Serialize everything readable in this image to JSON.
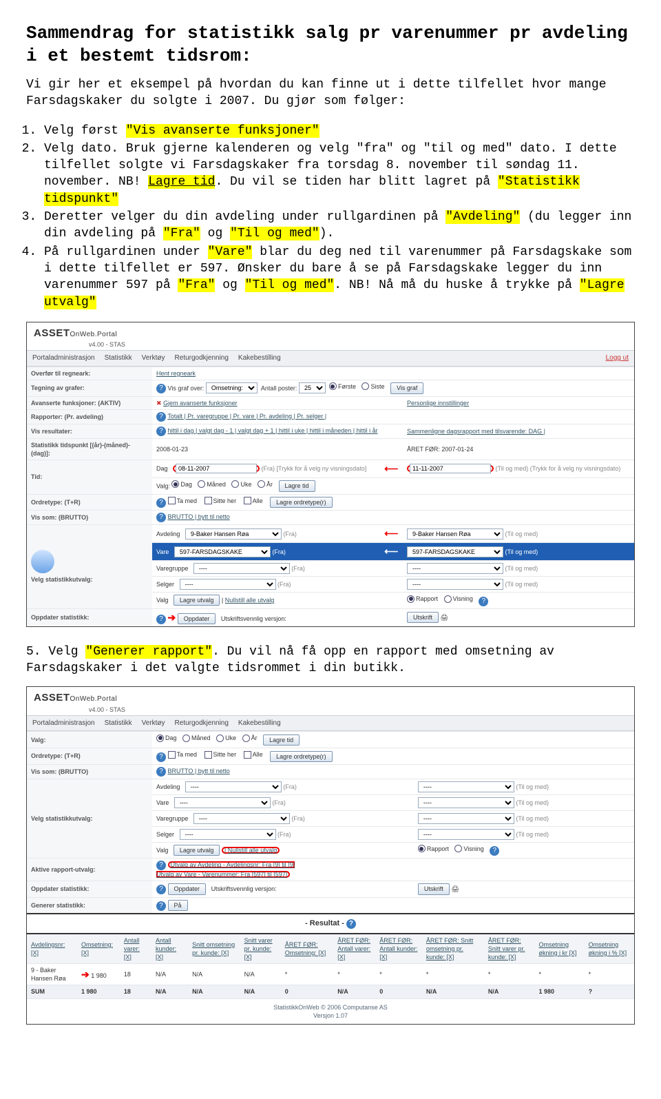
{
  "title": "Sammendrag for statistikk salg pr varenummer pr avdeling i et bestemt tidsrom:",
  "intro": "Vi gir her et eksempel på hvordan du kan finne ut i dette tilfellet hvor mange Farsdagskaker du solgte i 2007. Du gjør som følger:",
  "step1_a": "Velg først ",
  "step1_hl": "\"Vis avanserte funksjoner\"",
  "step2_a": "Velg dato. Bruk gjerne kalenderen og velg \"fra\" og \"til og med\" dato. I dette tilfellet solgte vi Farsdagskaker fra torsdag 8. november til søndag 11. november. NB! ",
  "step2_hl": "Lagre tid",
  "step2_b": ". Du vil se tiden har blitt lagret på ",
  "step2_hl2": "\"Statistikk tidspunkt\"",
  "step3_a": "Deretter velger du din avdeling under rullgardinen på ",
  "step3_hl1": "\"Avdeling\"",
  "step3_b": " (du legger inn din avdeling på ",
  "step3_hl2": "\"Fra\"",
  "step3_c": " og ",
  "step3_hl3": "\"Til og med\"",
  "step3_d": ").",
  "step4_a": "På rullgardinen under ",
  "step4_hl1": "\"Vare\"",
  "step4_b": " blar du deg ned til varenummer på Farsdagskake som i dette tilfellet er 597. Ønsker du bare å se på Farsdagskake legger du inn varenummer 597 på ",
  "step4_hl2": "\"Fra\"",
  "step4_c": " og ",
  "step4_hl3": "\"Til og med\"",
  "step4_d": ". NB! Nå må du huske å trykke på ",
  "step4_hl4": "\"Lagre utvalg\"",
  "step5_a": "5. Velg ",
  "step5_hl": "\"Generer rapport\"",
  "step5_b": ". Du vil nå få opp en rapport med omsetning av Farsdagskaker i det valgte tidsrommet i din butikk.",
  "logo": {
    "brand": "ASSET",
    "suffix": "OnWeb.Portal",
    "ver": "v4.00 - STAS"
  },
  "menu": [
    "Portaladministrasjon",
    "Statistikk",
    "Verktøy",
    "Returgodkjenning",
    "Kakebestilling"
  ],
  "logout": "Logg ut",
  "s1": {
    "rows": {
      "overfor": {
        "lab": "Overfør til regneark:",
        "act": "Hent regneark"
      },
      "tegn": {
        "lab": "Tegning av grafer:",
        "vis_label": "Vis graf over:",
        "vis_sel": "Omsetning:",
        "ant": "Antall poster:",
        "ant_sel": "25",
        "forste": "Første",
        "siste": "Siste",
        "btn": "Vis graf"
      },
      "avans": {
        "lab": "Avanserte funksjoner: (AKTIV)",
        "act": "Gjem avanserte funksjoner",
        "pers": "Personlige innstillinger"
      },
      "rapp": {
        "lab": "Rapporter: (Pr. avdeling)",
        "links": "Totalt | Pr. varegruppe | Pr. vare | Pr. avdeling | Pr. selger |"
      },
      "visres": {
        "lab": "Vis resultater:",
        "links": "hittil i dag | valgt dag - 1 | valgt dag + 1 | hittil i uke | hittil i måneden | hittil i år",
        "cmp": "Sammenligne dagsrapport med tilsvarende: DAG |"
      },
      "stat": {
        "lab": "Statistikk tidspunkt [(år)-(måned)-(dag)]:",
        "val": "2008-01-23",
        "prev": "ÅRET FØR: 2007-01-24"
      },
      "tid": {
        "lab": "Tid:",
        "dag": "Dag",
        "fra": "08-11-2007",
        "fra_lab": "(Fra) [Trykk for å velg ny visningsdato]",
        "til": "11-11-2007",
        "til_lab": "(Til og med) (Trykk for å velg ny visningsdato)",
        "valg": "Valg:",
        "r": [
          "Dag",
          "Måned",
          "Uke",
          "År"
        ],
        "btn": "Lagre tid"
      },
      "ord": {
        "lab": "Ordretype: (T+R)",
        "c": [
          "Ta med",
          "Sitte her",
          "Alle"
        ],
        "btn": "Lagre ordretype(r)"
      },
      "vis": {
        "lab": "Vis som: (BRUTTO)",
        "txt": "BRUTTO | bytt til netto"
      },
      "utvalg": {
        "lab": "Velg statistikkutvalg:",
        "avd": {
          "lab": "Avdeling",
          "fra": "9-Baker Hansen Røa",
          "til": "9-Baker Hansen Røa"
        },
        "vare": {
          "lab": "Vare",
          "fra": "597-FARSDAGSKAKE",
          "til": "597-FARSDAGSKAKE"
        },
        "vgrp": {
          "lab": "Varegruppe",
          "fra": "----",
          "til": "----"
        },
        "selg": {
          "lab": "Selger",
          "fra": "----",
          "til": "----"
        },
        "fra": "(Fra)",
        "til": "(Til og med)",
        "lagre": "Lagre utvalg",
        "null": "Nullstill alle utvalg",
        "rad1": "Rapport",
        "rad2": "Visning"
      },
      "opp": {
        "lab": "Oppdater statistikk:",
        "btn": "Oppdater",
        "uts": "Utskriftsvennlig versjon:",
        "utbtn": "Utskrift"
      }
    }
  },
  "s2": {
    "rows": {
      "valg": {
        "lab": "Valg:",
        "r": [
          "Dag",
          "Måned",
          "Uke",
          "År"
        ],
        "btn": "Lagre tid"
      },
      "ord": {
        "lab": "Ordretype: (T+R)",
        "c": [
          "Ta med",
          "Sitte her",
          "Alle"
        ],
        "btn": "Lagre ordretype(r)"
      },
      "vis": {
        "lab": "Vis som: (BRUTTO)",
        "txt": "BRUTTO | bytt til netto"
      },
      "utvalg": {
        "lab": "Velg statistikkutvalg:",
        "avd": {
          "lab": "Avdeling",
          "fra": "----",
          "til": "----"
        },
        "vare": {
          "lab": "Vare",
          "fra": "----",
          "til": "----"
        },
        "vgrp": {
          "lab": "Varegruppe",
          "fra": "----",
          "til": "----"
        },
        "selg": {
          "lab": "Selger",
          "fra": "----",
          "til": "----"
        },
        "fra": "(Fra)",
        "til": "(Til og med)",
        "lagre": "Lagre utvalg",
        "null": "Nullstill alle utvalg",
        "rad1": "Rapport",
        "rad2": "Visning"
      },
      "aktive": {
        "lab": "Aktive rapport-utvalg:",
        "l1": "Utvalg av Avdeling - Avdelingsnr: Fra [9] til [9]",
        "l2": "Utvalg av Vare - Varenummer: Fra [597] til [597]"
      },
      "opp": {
        "lab": "Oppdater statistikk:",
        "btn": "Oppdater",
        "uts": "Utskriftsvennlig versjon:",
        "utbtn": "Utskrift"
      },
      "gen": {
        "lab": "Generer statistikk:",
        "btn": "På"
      }
    },
    "result_title": "- Resultat -",
    "cols": [
      "Avdelingsnr: [X]",
      "Omsetning: [X]",
      "Antall varer: [X]",
      "Antall kunder: [X]",
      "Snitt omsetning pr. kunde: [X]",
      "Snitt varer pr. kunde: [X]",
      "ÅRET FØR: Omsetning: [X]",
      "ÅRET FØR: Antall varer: [X]",
      "ÅRET FØR: Antall kunder: [X]",
      "ÅRET FØR: Snitt omsetning pr. kunde: [X]",
      "ÅRET FØR: Snitt varer pr. kunde: [X]",
      "Omsetning økning i kr [X]",
      "Omsetning økning i % [X]"
    ],
    "row1": [
      "9 - Baker Hansen Røa",
      "1 980",
      "18",
      "N/A",
      "N/A",
      "N/A",
      "*",
      "*",
      "*",
      "*",
      "*",
      "*",
      "*"
    ],
    "row2": [
      "SUM",
      "1 980",
      "18",
      "N/A",
      "N/A",
      "N/A",
      "0",
      "N/A",
      "0",
      "N/A",
      "N/A",
      "1 980",
      "?"
    ],
    "footer1": "StatistikkOnWeb © 2006 Computanse AS",
    "footer2": "Versjon 1.07"
  }
}
